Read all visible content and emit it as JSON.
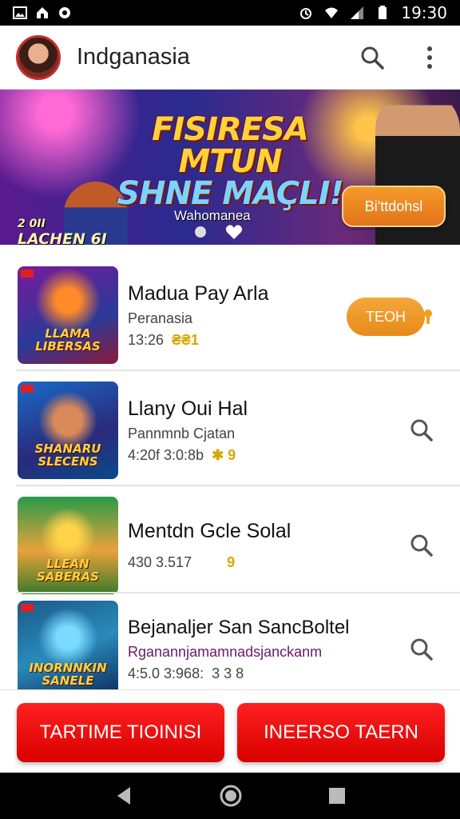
{
  "status_bar": {
    "time": "19:30"
  },
  "app_bar": {
    "title": "Indganasia"
  },
  "banner": {
    "title_line1": "FISIRESA MTUN",
    "title_line2": "SHNE MAÇLI!",
    "left_text": "LACHEN 6I",
    "left_top_text": "2 0II",
    "mid_text": "Wahomanea",
    "button_label": "Bi'ttdohsl"
  },
  "games": [
    {
      "title": "Madua Pay Arla",
      "subtitle": "Peranasia",
      "meta": "13:26",
      "meta_extra": "₴₴1",
      "thumb_text": "LLAMA LIBERSAS",
      "action": "pill",
      "action_label": "TEOH"
    },
    {
      "title": "Llany Oui Hal",
      "subtitle": "Pannmnb Cjatan",
      "meta": "4:20f 3:0:8b",
      "meta_extra": "✱ 9",
      "thumb_text": "SHANARU SLECENS",
      "action": "search"
    },
    {
      "title": "Mentdn Gcle Solal",
      "subtitle": "",
      "meta": "430 3.517",
      "meta_extra": "9",
      "thumb_text": "LLEAN SABERAS",
      "action": "search"
    },
    {
      "title": "Bejanaljer San SancBoltel",
      "subtitle": "Rganannjamamnadsjanckanm",
      "meta": "4:5.0 3:968:",
      "meta_extra": "3 3 8",
      "thumb_text": "INORNNKIN SANELE",
      "action": "search"
    }
  ],
  "bottom_buttons": {
    "left": "TARTIME TIOINISI",
    "right": "INEERSO TAERN"
  },
  "colors": {
    "accent_red": "#e00000",
    "accent_orange": "#e88a1a"
  }
}
